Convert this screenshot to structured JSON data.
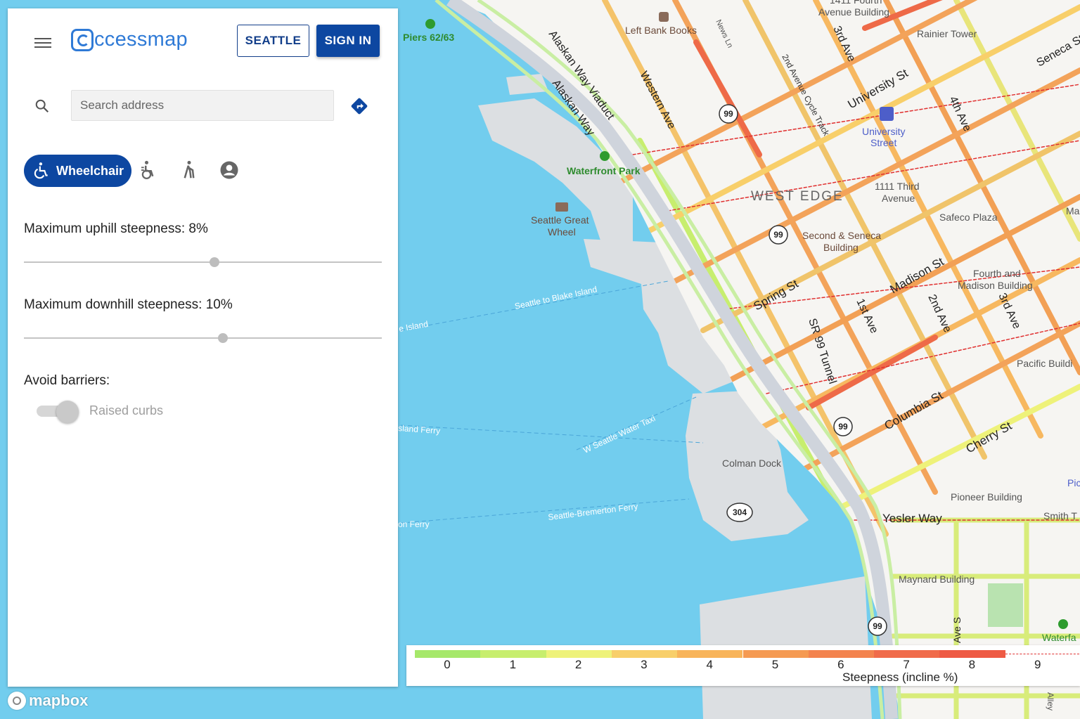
{
  "app": {
    "name": "ccessmap"
  },
  "header": {
    "region_button": "SEATTLE",
    "signin_button": "SIGN IN"
  },
  "search": {
    "placeholder": "Search address"
  },
  "modes": {
    "active_label": "Wheelchair",
    "active_icon": "wheelchair-icon",
    "others": [
      "powered-wheelchair-icon",
      "cane-icon",
      "custom-profile-icon"
    ]
  },
  "settings": {
    "uphill_label": "Maximum uphill steepness: 8%",
    "uphill_value": 8,
    "uphill_max": 15,
    "downhill_label": "Maximum downhill steepness: 10%",
    "downhill_value": 10,
    "downhill_max": 18,
    "barriers_label": "Avoid barriers:",
    "raised_curbs_label": "Raised curbs",
    "raised_curbs_enabled": false
  },
  "legend": {
    "title": "Steepness (incline %)",
    "ticks": [
      "0",
      "1",
      "2",
      "3",
      "4",
      "5",
      "6",
      "7",
      "8",
      "9"
    ],
    "colors": [
      "#a6e86a",
      "#c7ee6e",
      "#eef27a",
      "#f8cf6a",
      "#f8b45a",
      "#f59a52",
      "#f3834e",
      "#f06b4a",
      "#ee5a44"
    ]
  },
  "map": {
    "water_color": "#72cdee",
    "land_color": "#f6f5f2",
    "labels": [
      "Piers 62/63",
      "Left Bank Books",
      "News Ln",
      "1411 Fourth",
      "Avenue Building",
      "Rainier Tower",
      "3rd Ave",
      "Alaskan Way Viaduct",
      "Alaskan Way",
      "Western Ave",
      "2nd Avenue Cycle Track",
      "University St",
      "University",
      "Street",
      "4th Ave",
      "Seneca St",
      "Waterfront Park",
      "WEST EDGE",
      "1111 Third",
      "Avenue",
      "Seattle Great",
      "Wheel",
      "Second & Seneca",
      "Building",
      "Safeco Plaza",
      "Madison St",
      "Spring St",
      "Fourth and",
      "Madison Building",
      "Seattle to Blake Island",
      "e Island",
      "1st Ave",
      "2nd Ave",
      "3rd Ave",
      "SR 99 Tunnel",
      "Pacific Buildi",
      "Columbia St",
      "Cherry St",
      "W Seattle Water Taxi",
      "sland Ferry",
      "Colman Dock",
      "Pioneer Building",
      "Yesler Way",
      "Smith T",
      "Seattle-Bremerton Ferry",
      "on Ferry",
      "Maynard Building",
      "Ave S",
      "Waterfa",
      "Pic",
      "Ma",
      "Alley"
    ],
    "route_shields": [
      "99",
      "99",
      "99",
      "99",
      "304"
    ]
  },
  "attribution": {
    "mapbox": "mapbox"
  }
}
